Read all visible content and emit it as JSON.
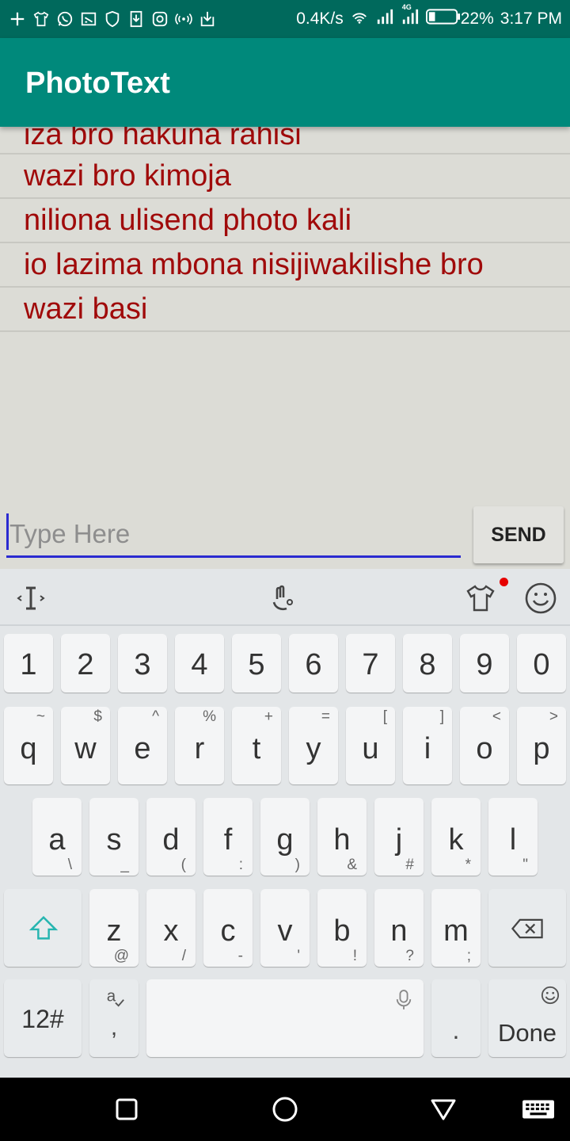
{
  "status_bar": {
    "net_speed": "0.4K/s",
    "network_type": "4G",
    "battery": "22%",
    "time": "3:17 PM",
    "notification_icons": [
      "plus-icon",
      "shirt-icon",
      "whatsapp-icon",
      "cast-icon",
      "shield-icon",
      "download-icon",
      "instagram-icon",
      "hotspot-icon",
      "download-box-icon"
    ]
  },
  "app_bar": {
    "title": "PhotoText"
  },
  "messages": [
    "iza bro hakuna rahisi",
    "wazi bro kimoja",
    "niliona ulisend photo kali",
    "io lazima mbona nisijiwakilishe bro",
    "wazi basi"
  ],
  "composer": {
    "placeholder": "Type Here",
    "value": "",
    "send_label": "SEND"
  },
  "keyboard": {
    "toolbar": [
      "cursor-icon",
      "handwriting-icon",
      "theme-shirt-icon",
      "emoji-icon"
    ],
    "numbers": [
      "1",
      "2",
      "3",
      "4",
      "5",
      "6",
      "7",
      "8",
      "9",
      "0"
    ],
    "row1": [
      {
        "k": "q",
        "s": "~"
      },
      {
        "k": "w",
        "s": "$"
      },
      {
        "k": "e",
        "s": "^"
      },
      {
        "k": "r",
        "s": "%"
      },
      {
        "k": "t",
        "s": "+"
      },
      {
        "k": "y",
        "s": "="
      },
      {
        "k": "u",
        "s": "["
      },
      {
        "k": "i",
        "s": "]"
      },
      {
        "k": "o",
        "s": "<"
      },
      {
        "k": "p",
        "s": ">"
      }
    ],
    "row2": [
      {
        "k": "a",
        "s": "\\"
      },
      {
        "k": "s",
        "s": "_"
      },
      {
        "k": "d",
        "s": "("
      },
      {
        "k": "f",
        "s": ":"
      },
      {
        "k": "g",
        "s": ")"
      },
      {
        "k": "h",
        "s": "&"
      },
      {
        "k": "j",
        "s": "#"
      },
      {
        "k": "k",
        "s": "*"
      },
      {
        "k": "l",
        "s": "\""
      }
    ],
    "row3": [
      {
        "k": "z",
        "s": "@"
      },
      {
        "k": "x",
        "s": "/"
      },
      {
        "k": "c",
        "s": "-"
      },
      {
        "k": "v",
        "s": "'"
      },
      {
        "k": "b",
        "s": "!"
      },
      {
        "k": "n",
        "s": "?"
      },
      {
        "k": "m",
        "s": ";"
      }
    ],
    "symbols_label": "12#",
    "comma_label": ",",
    "period_label": ".",
    "done_label": "Done",
    "accent_color": "#26b5b0"
  },
  "nav_bar": [
    "recents-icon",
    "home-icon",
    "back-icon",
    "keyboard-switch-icon"
  ],
  "colors": {
    "status_bar": "#00695c",
    "app_bar": "#00897b",
    "message_text": "#a00a0a",
    "input_underline": "#2b2bd0"
  }
}
